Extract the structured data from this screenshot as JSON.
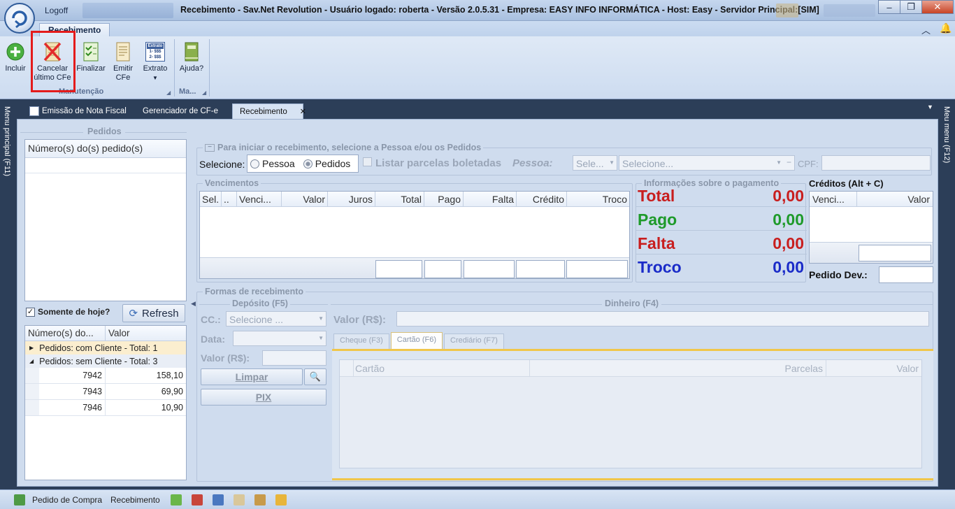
{
  "window": {
    "logoff": "Logoff",
    "title": "Recebimento - Sav.Net Revolution - Usuário logado: roberta - Versão 2.0.5.31 - Empresa: EASY INFO INFORMÁTICA - Host: Easy - Servidor Principal:[SIM]",
    "minimize": "‒",
    "maximize": "❐",
    "close": "✕"
  },
  "ribbon": {
    "tab": "Recebimento",
    "buttons": {
      "incluir": "Incluir",
      "cancelar_l1": "Cancelar",
      "cancelar_l2": "último CFe",
      "finalizar": "Finalizar",
      "emitir_l1": "Emitir",
      "emitir_l2": "CFe",
      "extrato": "Extrato",
      "ajuda": "Ajuda?"
    },
    "extrato_icon_lines": [
      "Extrato",
      "1- $$$",
      "2- $$$"
    ],
    "groups": {
      "manutencao": "Manutenção",
      "ma": "Ma..."
    }
  },
  "doc_tabs": {
    "emissao": "Emissão de Nota Fiscal",
    "gerenciador": "Gerenciador de CF-e",
    "recebimento": "Recebimento",
    "close": "✕"
  },
  "side": {
    "left": "Menu principal (F11)",
    "right": "Meu menu (F12)"
  },
  "pedidos": {
    "title": "Pedidos",
    "col_numero": "Número(s) do(s) pedido(s)",
    "somente_hoje": "Somente de hoje?",
    "refresh": "Refresh",
    "grid_col_numero": "Número(s) do...",
    "grid_col_valor": "Valor",
    "group_com": "Pedidos: com Cliente - Total: 1",
    "group_sem": "Pedidos: sem Cliente - Total: 3",
    "rows": [
      {
        "numero": "7942",
        "valor": "158,10"
      },
      {
        "numero": "7943",
        "valor": "69,90"
      },
      {
        "numero": "7946",
        "valor": "10,90"
      }
    ]
  },
  "iniciar": {
    "legend": "Para iniciar o recebimento, selecione a Pessoa e/ou os Pedidos",
    "selecione": "Selecione:",
    "pessoa_radio": "Pessoa",
    "pedidos_radio": "Pedidos",
    "listar": "Listar parcelas boletadas",
    "pessoa_label": "Pessoa:",
    "sele_placeholder": "Sele...",
    "selecione_placeholder": "Selecione...",
    "cpf": "CPF:"
  },
  "vencimentos": {
    "title": "Vencimentos",
    "cols": [
      "Sel.",
      "..",
      "Venci...",
      "Valor",
      "Juros",
      "Total",
      "Pago",
      "Falta",
      "Crédito",
      "Troco"
    ]
  },
  "info": {
    "title": "Informações sobre o pagamento",
    "rows": [
      {
        "label": "Total",
        "value": "0,00",
        "color": "#c81e1e"
      },
      {
        "label": "Pago",
        "value": "0,00",
        "color": "#1e9a2a"
      },
      {
        "label": "Falta",
        "value": "0,00",
        "color": "#c81e1e"
      },
      {
        "label": "Troco",
        "value": "0,00",
        "color": "#1a2bc8"
      }
    ]
  },
  "creditos": {
    "title": "Créditos (Alt + C)",
    "col_venci": "Venci...",
    "col_valor": "Valor",
    "pedido_dev": "Pedido Dev.:"
  },
  "formas": {
    "legend": "Formas de recebimento",
    "deposito": "Depósito (F5)",
    "cc": "CC.:",
    "cc_placeholder": "Selecione ...",
    "data": "Data:",
    "valor": "Valor (R$):",
    "limpar": "Limpar",
    "pix": "PIX",
    "dinheiro": "Dinheiro (F4)",
    "dinheiro_valor": "Valor (R$):",
    "tabs": [
      "Cheque (F3)",
      "Cartão (F6)",
      "Crediário (F7)"
    ],
    "grid_cols": [
      "Cartão",
      "Parcelas",
      "Valor"
    ]
  },
  "statusbar": {
    "pedido_compra": "Pedido de Compra",
    "recebimento": "Recebimento"
  }
}
